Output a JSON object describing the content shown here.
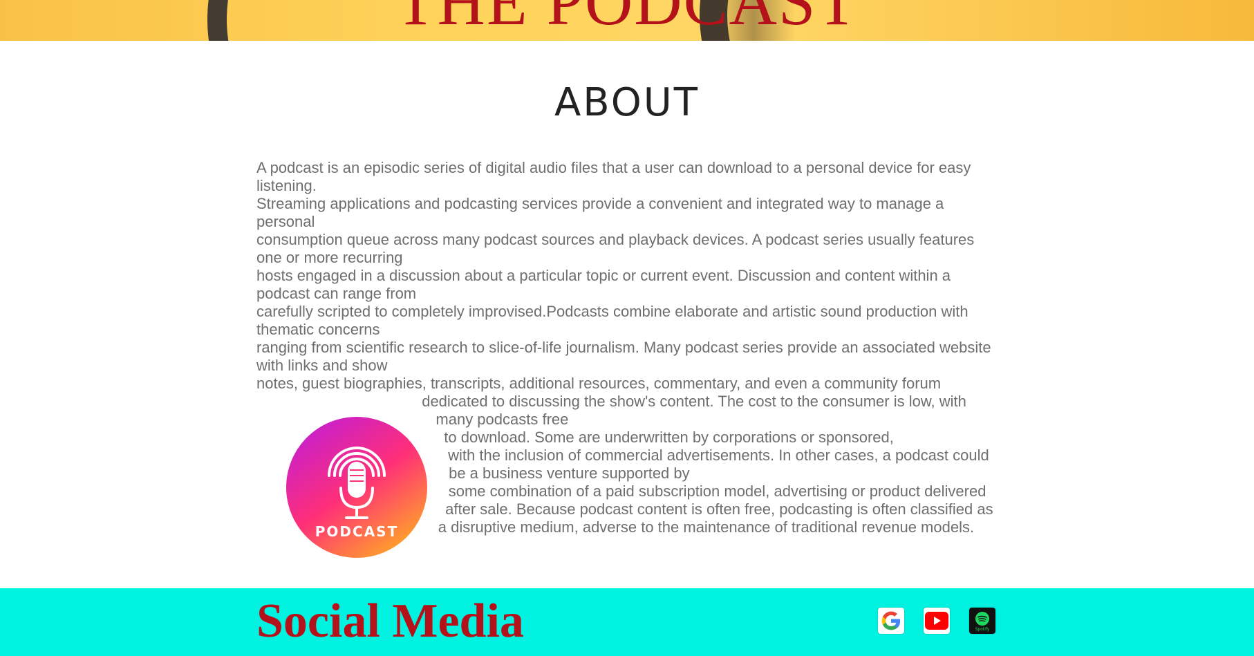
{
  "hero": {
    "title": "THE PODCAST"
  },
  "about": {
    "heading": "ABOUT",
    "paragraphs_top": [
      "A podcast is an episodic series of digital audio files that a user can download to a personal device for easy listening.",
      "Streaming applications and podcasting services provide a convenient and integrated way to manage a personal",
      "consumption queue across many podcast sources and playback devices. A podcast series usually features one or more recurring",
      "hosts engaged in a discussion about a particular topic or current event. Discussion and content within a podcast can range from",
      "carefully scripted to completely improvised.Podcasts combine elaborate and artistic sound production with thematic concerns",
      "ranging from scientific research to slice-of-life journalism. Many podcast series provide an associated website with links and show",
      "notes, guest biographies, transcripts, additional resources, commentary, and even a community forum"
    ],
    "paragraphs_wrapped": [
      "dedicated to discussing the show's content. The cost to the consumer is low, with many podcasts free",
      "to download. Some are underwritten by corporations or sponsored,",
      "with the inclusion of commercial advertisements. In other cases, a podcast could be a business venture supported by",
      "some combination of a paid subscription model, advertising or product delivered",
      "after sale. Because podcast content is often free, podcasting is often classified as a disruptive medium, adverse to the maintenance of traditional revenue models."
    ],
    "logo": {
      "label": "PODCAST",
      "icon": "microphone-icon",
      "gradient_start": "#c21ed6",
      "gradient_mid": "#ff2f78",
      "gradient_end": "#ffb21f"
    }
  },
  "footer": {
    "title": "Social Media",
    "background": "#00f2e1",
    "title_color": "#b3121a",
    "links": [
      {
        "name": "google",
        "icon": "google-icon"
      },
      {
        "name": "youtube",
        "icon": "youtube-icon"
      },
      {
        "name": "spotify",
        "icon": "spotify-icon",
        "label": "Spotify"
      }
    ]
  },
  "colors": {
    "accent_red": "#b3121a",
    "body_text": "#6e6e6e",
    "heading_text": "#222222"
  }
}
